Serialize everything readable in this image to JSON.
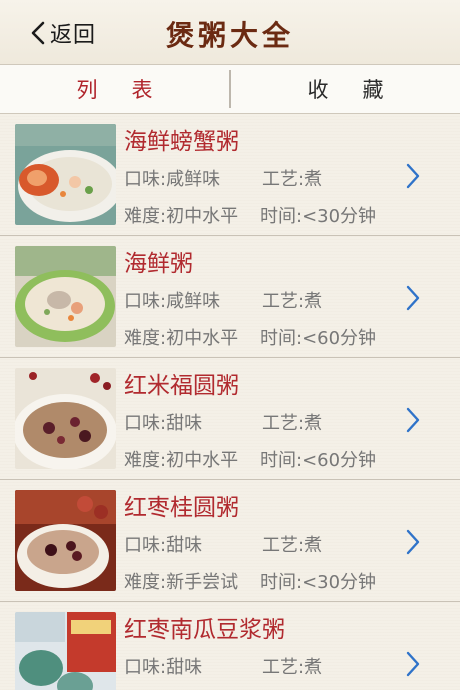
{
  "nav": {
    "back_label": "返回",
    "title": "煲粥大全"
  },
  "tabs": [
    {
      "label": "列表",
      "selected": true
    },
    {
      "label": "收藏",
      "selected": false
    }
  ],
  "colors": {
    "accent_red": "#b12a2f",
    "title_brown": "#6b2a12",
    "chevron_blue": "#2f73c9"
  },
  "recipes": [
    {
      "name": "海鲜螃蟹粥",
      "taste": "口味:咸鲜味",
      "craft": "工艺:煮",
      "difficulty": "难度:初中水平",
      "duration": "时间:<30分钟"
    },
    {
      "name": "海鲜粥",
      "taste": "口味:咸鲜味",
      "craft": "工艺:煮",
      "difficulty": "难度:初中水平",
      "duration": "时间:<60分钟"
    },
    {
      "name": "红米福圆粥",
      "taste": "口味:甜味",
      "craft": "工艺:煮",
      "difficulty": "难度:初中水平",
      "duration": "时间:<60分钟"
    },
    {
      "name": "红枣桂圆粥",
      "taste": "口味:甜味",
      "craft": "工艺:煮",
      "difficulty": "难度:新手尝试",
      "duration": "时间:<30分钟"
    },
    {
      "name": "红枣南瓜豆浆粥",
      "taste": "口味:甜味",
      "craft": "工艺:煮",
      "difficulty": "",
      "duration": ""
    }
  ]
}
